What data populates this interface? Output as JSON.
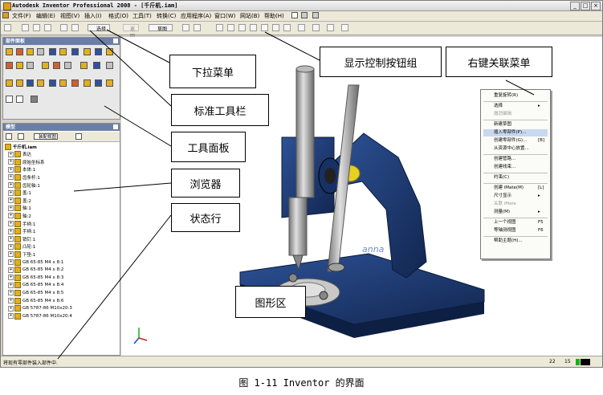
{
  "window": {
    "title": "Autodesk Inventor Professional 2008 - [千斤机.iam]",
    "buttons": [
      "_",
      "□",
      "×"
    ]
  },
  "menubar": [
    "文件(F)",
    "编辑(E)",
    "视图(V)",
    "插入(I)",
    "格式(O)",
    "工具(T)",
    "转换(C)",
    "应用程序(A)",
    "窗口(W)",
    "网站(B)",
    "帮助(H)"
  ],
  "toolbar": {
    "select_label": "选择",
    "return_label": "返回",
    "sketch_label": "草图"
  },
  "panel_bar": {
    "title": "部件面板"
  },
  "browser": {
    "title": "模型",
    "view_label": "装配视图",
    "rows": [
      {
        "label": "千斤机.iam",
        "indent": 0,
        "expander": ""
      },
      {
        "label": "表达",
        "indent": 1,
        "expander": "+"
      },
      {
        "label": "原始坐标系",
        "indent": 1,
        "expander": "+"
      },
      {
        "label": "本体:1",
        "indent": 1,
        "expander": "+"
      },
      {
        "label": "齿条杆:1",
        "indent": 1,
        "expander": "+"
      },
      {
        "label": "齿轮轴:1",
        "indent": 1,
        "expander": "+"
      },
      {
        "label": "盖:1",
        "indent": 1,
        "expander": "+"
      },
      {
        "label": "盖:2",
        "indent": 1,
        "expander": "+"
      },
      {
        "label": "轴:1",
        "indent": 1,
        "expander": "+"
      },
      {
        "label": "轴:2",
        "indent": 1,
        "expander": "+"
      },
      {
        "label": "手柄:1",
        "indent": 1,
        "expander": "+"
      },
      {
        "label": "手柄:1",
        "indent": 1,
        "expander": "+"
      },
      {
        "label": "销钉:1",
        "indent": 1,
        "expander": "+"
      },
      {
        "label": "凸轮:1",
        "indent": 1,
        "expander": "+"
      },
      {
        "label": "下垫:1",
        "indent": 1,
        "expander": "+"
      },
      {
        "label": "GB 65-85 M4 x 8:1",
        "indent": 1,
        "expander": "+"
      },
      {
        "label": "GB 65-85 M4 x 8:2",
        "indent": 1,
        "expander": "+"
      },
      {
        "label": "GB 65-85 M4 x 8:3",
        "indent": 1,
        "expander": "+"
      },
      {
        "label": "GB 65-85 M4 x 8:4",
        "indent": 1,
        "expander": "+"
      },
      {
        "label": "GB 65-85 M4 x 8:5",
        "indent": 1,
        "expander": "+"
      },
      {
        "label": "GB 65-85 M4 x 8:6",
        "indent": 1,
        "expander": "+"
      },
      {
        "label": "GB 5787-86 M10x20:3",
        "indent": 1,
        "expander": "+"
      },
      {
        "label": "GB 5787-86 M10x20:4",
        "indent": 1,
        "expander": "+"
      }
    ]
  },
  "context_menu": {
    "items": [
      {
        "label": "重复旋转(R)",
        "shortcut": "",
        "type": "item"
      },
      {
        "type": "sep"
      },
      {
        "label": "选择",
        "shortcut": "▸",
        "type": "item"
      },
      {
        "label": "撤消编辑",
        "shortcut": "",
        "type": "disabled"
      },
      {
        "type": "sep"
      },
      {
        "label": "新建草图",
        "shortcut": "",
        "type": "item"
      },
      {
        "label": "插入零部件(P)...",
        "shortcut": "",
        "type": "highlight"
      },
      {
        "label": "创建零部件(G)...",
        "shortcut": "[B]",
        "type": "item"
      },
      {
        "label": "从资源中心放置...",
        "shortcut": "",
        "type": "item"
      },
      {
        "type": "sep"
      },
      {
        "label": "创建管路...",
        "shortcut": "",
        "type": "item"
      },
      {
        "label": "创建线束...",
        "shortcut": "",
        "type": "item"
      },
      {
        "type": "sep"
      },
      {
        "label": "约束(C)",
        "shortcut": "",
        "type": "item"
      },
      {
        "type": "sep"
      },
      {
        "label": "创建 iMate(M)",
        "shortcut": "[L]",
        "type": "item"
      },
      {
        "label": "尺寸显示",
        "shortcut": "▸",
        "type": "item"
      },
      {
        "label": "关联 iMate",
        "shortcut": "",
        "type": "disabled"
      },
      {
        "label": "测量(M)",
        "shortcut": "▸",
        "type": "item"
      },
      {
        "type": "sep"
      },
      {
        "label": "上一个视图",
        "shortcut": "F5",
        "type": "item"
      },
      {
        "label": "等轴测视图",
        "shortcut": "F6",
        "type": "item"
      },
      {
        "type": "sep"
      },
      {
        "label": "帮助主题(H)...",
        "shortcut": "",
        "type": "item"
      }
    ]
  },
  "status": {
    "text": "将现有零部件装入部件中.",
    "num1": "22",
    "num2": "15"
  },
  "callouts": {
    "dropdown_menu": "下拉菜单",
    "display_buttons": "显示控制按钮组",
    "context_menu": "右键关联菜单",
    "standard_toolbar": "标准工具栏",
    "tool_panel": "工具面板",
    "browser": "浏览器",
    "status_bar": "状态行",
    "graphics_area": "图形区"
  },
  "model": {
    "brand_text": "anna"
  },
  "caption": "图 1-11  Inventor 的界面",
  "colors": {
    "model_blue": "#1d3a70",
    "shaft_grey": "#a8a8a8",
    "accent_yellow": "#e8d020"
  }
}
